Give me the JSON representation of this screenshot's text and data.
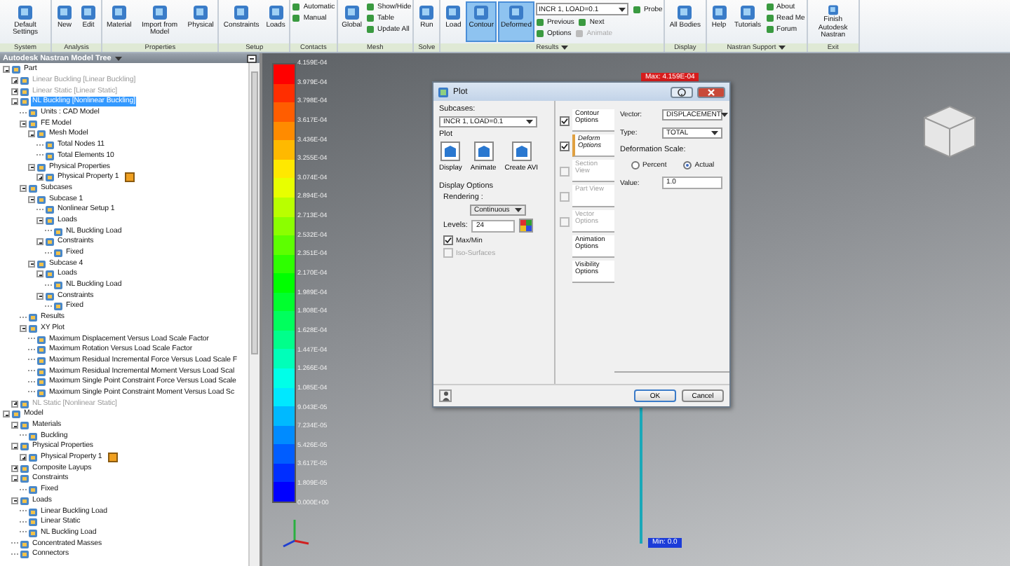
{
  "ribbon": {
    "groups": [
      {
        "label": "System",
        "menu": false,
        "items": [
          {
            "kind": "large",
            "label": "Default Settings",
            "selected": false
          }
        ]
      },
      {
        "label": "Analysis",
        "menu": false,
        "items": [
          {
            "kind": "large",
            "label": "New",
            "selected": false
          },
          {
            "kind": "large",
            "label": "Edit",
            "selected": false
          }
        ]
      },
      {
        "label": "Properties",
        "menu": false,
        "items": [
          {
            "kind": "large",
            "label": "Material",
            "selected": false
          },
          {
            "kind": "large",
            "label": "Import from Model",
            "selected": false
          },
          {
            "kind": "large",
            "label": "Physical",
            "selected": false
          }
        ]
      },
      {
        "label": "Setup",
        "menu": false,
        "items": [
          {
            "kind": "large",
            "label": "Constraints",
            "selected": false
          },
          {
            "kind": "large",
            "label": "Loads",
            "selected": false
          }
        ]
      },
      {
        "label": "Contacts",
        "menu": false,
        "items": [
          {
            "kind": "stack",
            "rows": [
              [
                {
                  "kind": "small",
                  "label": "Automatic",
                  "disabled": false
                }
              ],
              [
                {
                  "kind": "small",
                  "label": "Manual",
                  "disabled": false
                }
              ]
            ]
          }
        ]
      },
      {
        "label": "Mesh",
        "menu": false,
        "items": [
          {
            "kind": "large",
            "label": "Global",
            "selected": false
          },
          {
            "kind": "stack",
            "rows": [
              [
                {
                  "kind": "small",
                  "label": "Show/Hide",
                  "disabled": false
                }
              ],
              [
                {
                  "kind": "small",
                  "label": "Table",
                  "disabled": false
                }
              ],
              [
                {
                  "kind": "small",
                  "label": "Update All",
                  "disabled": false
                }
              ]
            ]
          }
        ]
      },
      {
        "label": "Solve",
        "menu": false,
        "items": [
          {
            "kind": "large",
            "label": "Run",
            "selected": false
          }
        ]
      },
      {
        "label": "Results",
        "menu": true,
        "items": [
          {
            "kind": "large",
            "label": "Load",
            "selected": false
          },
          {
            "kind": "large",
            "label": "Contour",
            "selected": true
          },
          {
            "kind": "large",
            "label": "Deformed",
            "selected": true
          },
          {
            "kind": "stack",
            "rows": [
              [
                {
                  "kind": "dropdown",
                  "value": "INCR 1, LOAD=0.1"
                },
                {
                  "kind": "small",
                  "label": "Probe",
                  "disabled": false
                }
              ],
              [
                {
                  "kind": "small",
                  "label": "Previous",
                  "disabled": false
                },
                {
                  "kind": "small",
                  "label": "Next",
                  "disabled": false
                }
              ],
              [
                {
                  "kind": "small",
                  "label": "Options",
                  "disabled": false
                },
                {
                  "kind": "small",
                  "label": "Animate",
                  "disabled": true
                }
              ]
            ]
          }
        ]
      },
      {
        "label": "Display",
        "menu": false,
        "items": [
          {
            "kind": "large",
            "label": "All Bodies",
            "selected": false
          }
        ]
      },
      {
        "label": "Nastran Support",
        "menu": true,
        "items": [
          {
            "kind": "large",
            "label": "Help",
            "selected": false
          },
          {
            "kind": "large",
            "label": "Tutorials",
            "selected": false
          },
          {
            "kind": "stack",
            "rows": [
              [
                {
                  "kind": "small",
                  "label": "About",
                  "disabled": false
                }
              ],
              [
                {
                  "kind": "small",
                  "label": "Read Me",
                  "disabled": false
                }
              ],
              [
                {
                  "kind": "small",
                  "label": "Forum",
                  "disabled": false
                }
              ]
            ]
          }
        ]
      },
      {
        "label": "Exit",
        "menu": false,
        "items": [
          {
            "kind": "large",
            "label": "Finish Autodesk Nastran",
            "selected": false
          }
        ]
      }
    ]
  },
  "model_tree": {
    "title": "Autodesk Nastran Model Tree",
    "items": [
      {
        "label": "Part",
        "kind": "branch",
        "expanded": true,
        "children": [
          {
            "label": "Linear Buckling [Linear Buckling]",
            "kind": "branch",
            "expanded": false,
            "dimmed": true,
            "selected": false
          },
          {
            "label": "Linear Static [Linear Static]",
            "kind": "branch",
            "expanded": false,
            "dimmed": true,
            "selected": false
          },
          {
            "label": "NL Buckling [Nonlinear Buckling]",
            "kind": "branch",
            "expanded": true,
            "dimmed": false,
            "selected": true,
            "children": [
              {
                "label": "Units : CAD Model",
                "kind": "leaf"
              },
              {
                "label": "FE Model",
                "kind": "branch",
                "expanded": true,
                "children": [
                  {
                    "label": "Mesh Model",
                    "kind": "branch",
                    "expanded": true,
                    "children": [
                      {
                        "label": "Total Nodes 11",
                        "kind": "leaf"
                      },
                      {
                        "label": "Total Elements 10",
                        "kind": "leaf"
                      }
                    ]
                  },
                  {
                    "label": "Physical Properties",
                    "kind": "branch",
                    "expanded": true,
                    "children": [
                      {
                        "label": "Physical Property 1",
                        "kind": "branch",
                        "expanded": false,
                        "color": "#f0a020"
                      }
                    ]
                  }
                ]
              },
              {
                "label": "Subcases",
                "kind": "branch",
                "expanded": true,
                "children": [
                  {
                    "label": "Subcase 1",
                    "kind": "branch",
                    "expanded": true,
                    "children": [
                      {
                        "label": "Nonlinear Setup 1",
                        "kind": "leaf"
                      },
                      {
                        "label": "Loads",
                        "kind": "branch",
                        "expanded": true,
                        "children": [
                          {
                            "label": "NL Buckling Load",
                            "kind": "leaf"
                          }
                        ]
                      },
                      {
                        "label": "Constraints",
                        "kind": "branch",
                        "expanded": true,
                        "children": [
                          {
                            "label": "Fixed",
                            "kind": "leaf"
                          }
                        ]
                      }
                    ]
                  },
                  {
                    "label": "Subcase 4",
                    "kind": "branch",
                    "expanded": true,
                    "children": [
                      {
                        "label": "Loads",
                        "kind": "branch",
                        "expanded": true,
                        "children": [
                          {
                            "label": "NL Buckling Load",
                            "kind": "leaf"
                          }
                        ]
                      },
                      {
                        "label": "Constraints",
                        "kind": "branch",
                        "expanded": true,
                        "children": [
                          {
                            "label": "Fixed",
                            "kind": "leaf"
                          }
                        ]
                      }
                    ]
                  }
                ]
              },
              {
                "label": "Results",
                "kind": "leaf"
              },
              {
                "label": "XY Plot",
                "kind": "branch",
                "expanded": true,
                "children": [
                  {
                    "label": "Maximum Displacement Versus Load Scale Factor",
                    "kind": "leaf"
                  },
                  {
                    "label": "Maximum Rotation Versus Load Scale Factor",
                    "kind": "leaf"
                  },
                  {
                    "label": "Maximum Residual Incremental Force Versus Load Scale F",
                    "kind": "leaf"
                  },
                  {
                    "label": "Maximum Residual Incremental Moment Versus Load Scal",
                    "kind": "leaf"
                  },
                  {
                    "label": "Maximum Single Point Constraint Force Versus Load Scale",
                    "kind": "leaf"
                  },
                  {
                    "label": "Maximum Single Point Constraint Moment Versus Load Sc",
                    "kind": "leaf"
                  }
                ]
              }
            ]
          },
          {
            "label": "NL Static [Nonlinear Static]",
            "kind": "branch",
            "expanded": false,
            "dimmed": true,
            "selected": false
          }
        ]
      },
      {
        "label": "Model",
        "kind": "branch",
        "expanded": true,
        "children": [
          {
            "label": "Materials",
            "kind": "branch",
            "expanded": true,
            "children": [
              {
                "label": "Buckling",
                "kind": "leaf"
              }
            ]
          },
          {
            "label": "Physical Properties",
            "kind": "branch",
            "expanded": true,
            "children": [
              {
                "label": "Physical Property 1",
                "kind": "branch",
                "expanded": false,
                "color": "#f0a020"
              }
            ]
          },
          {
            "label": "Composite Layups",
            "kind": "branch",
            "expanded": false
          },
          {
            "label": "Constraints",
            "kind": "branch",
            "expanded": true,
            "children": [
              {
                "label": "Fixed",
                "kind": "leaf"
              }
            ]
          },
          {
            "label": "Loads",
            "kind": "branch",
            "expanded": true,
            "children": [
              {
                "label": "Linear Buckling Load",
                "kind": "leaf"
              },
              {
                "label": "Linear Static",
                "kind": "leaf"
              },
              {
                "label": "NL Buckling Load",
                "kind": "leaf"
              }
            ]
          },
          {
            "label": "Concentrated Masses",
            "kind": "leaf"
          },
          {
            "label": "Connectors",
            "kind": "leaf"
          }
        ]
      }
    ]
  },
  "viewport": {
    "legend": [
      "4.159E-04",
      "3.979E-04",
      "3.798E-04",
      "3.617E-04",
      "3.436E-04",
      "3.255E-04",
      "3.074E-04",
      "2.894E-04",
      "2.713E-04",
      "2.532E-04",
      "2.351E-04",
      "2.170E-04",
      "1.989E-04",
      "1.808E-04",
      "1.628E-04",
      "1.447E-04",
      "1.266E-04",
      "1.085E-04",
      "9.043E-05",
      "7.234E-05",
      "5.426E-05",
      "3.617E-05",
      "1.809E-05",
      "0.000E+00"
    ],
    "max_label": "Max: 4.159E-04",
    "min_label": "Min: 0.0"
  },
  "plot_dialog": {
    "title": "Plot",
    "subcases_label": "Subcases:",
    "subcase": "INCR 1, LOAD=0.1",
    "plot_label": "Plot",
    "plot_buttons": [
      "Display",
      "Animate",
      "Create AVI"
    ],
    "display_options_label": "Display Options",
    "rendering_label": "Rendering :",
    "rendering": "Continuous",
    "levels_label": "Levels:",
    "levels": "24",
    "checks": [
      {
        "label": "Max/Min",
        "checked": true,
        "disabled": false
      },
      {
        "label": "Iso-Surfaces",
        "checked": false,
        "disabled": true
      }
    ],
    "tabs": [
      {
        "label": "Contour Options",
        "kind": "check",
        "checked": true,
        "disabled": false,
        "selected": false
      },
      {
        "label": "Deform Options",
        "kind": "check",
        "checked": true,
        "disabled": false,
        "selected": true
      },
      {
        "label": "Section View",
        "kind": "check",
        "checked": false,
        "disabled": true,
        "selected": false
      },
      {
        "label": "Part View",
        "kind": "check",
        "checked": false,
        "disabled": true,
        "selected": false
      },
      {
        "label": "Vector Options",
        "kind": "check",
        "checked": false,
        "disabled": true,
        "selected": false
      },
      {
        "label": "Animation Options",
        "kind": "plain",
        "selected": false
      },
      {
        "label": "Visibility Options",
        "kind": "plain",
        "selected": false
      }
    ],
    "vector_label": "Vector:",
    "vector": "DISPLACEMENT",
    "type_label": "Type:",
    "type": "TOTAL",
    "scale_label": "Deformation Scale:",
    "scale_options": [
      {
        "label": "Percent",
        "selected": false
      },
      {
        "label": "Actual",
        "selected": true
      }
    ],
    "value_label": "Value:",
    "value": "1.0",
    "ok": "OK",
    "cancel": "Cancel"
  }
}
